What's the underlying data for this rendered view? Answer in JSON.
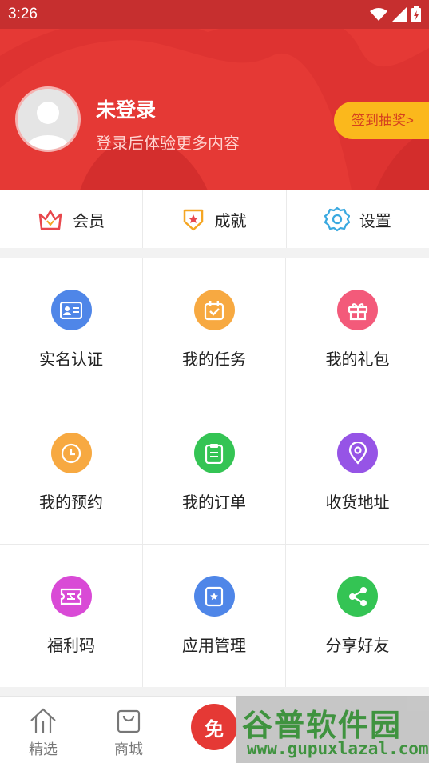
{
  "status": {
    "time": "3:26"
  },
  "profile": {
    "name": "未登录",
    "subtitle": "登录后体验更多内容",
    "signin_label": "签到抽奖>"
  },
  "quick": [
    {
      "label": "会员",
      "icon": "crown-icon"
    },
    {
      "label": "成就",
      "icon": "badge-star-icon"
    },
    {
      "label": "设置",
      "icon": "gear-icon"
    }
  ],
  "grid": [
    {
      "label": "实名认证",
      "icon": "id-card-icon",
      "color": "#4f86e8"
    },
    {
      "label": "我的任务",
      "icon": "calendar-check-icon",
      "color": "#f7a941"
    },
    {
      "label": "我的礼包",
      "icon": "gift-icon",
      "color": "#f35a7a"
    },
    {
      "label": "我的预约",
      "icon": "clock-icon",
      "color": "#f7a941"
    },
    {
      "label": "我的订单",
      "icon": "clipboard-icon",
      "color": "#34c454"
    },
    {
      "label": "收货地址",
      "icon": "location-icon",
      "color": "#9654e6"
    },
    {
      "label": "福利码",
      "icon": "ticket-icon",
      "color": "#d94ad6"
    },
    {
      "label": "应用管理",
      "icon": "app-manage-icon",
      "color": "#4f86e8"
    },
    {
      "label": "分享好友",
      "icon": "share-icon",
      "color": "#34c454"
    }
  ],
  "nav": {
    "items": [
      {
        "label": "精选",
        "icon": "home-icon"
      },
      {
        "label": "商城",
        "icon": "shopping-bag-icon"
      }
    ],
    "free_label": "免"
  },
  "watermark": {
    "title": "谷普软件园",
    "url": "www.gupuxlazal.com"
  },
  "colors": {
    "header_red": "#e53935",
    "status_red": "#c62f2f",
    "signin_yellow": "#fbb81c"
  }
}
